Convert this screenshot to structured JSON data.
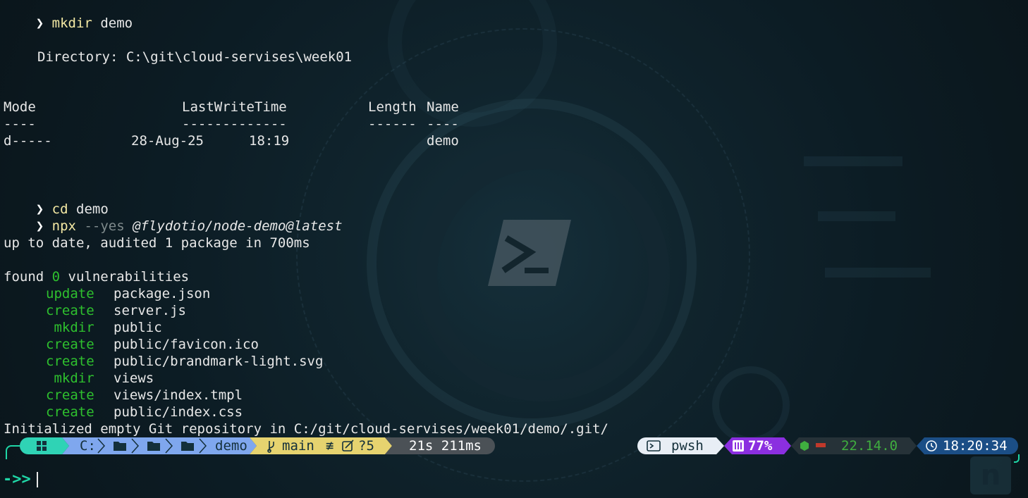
{
  "cmd1": {
    "verb": "mkdir",
    "arg": "demo"
  },
  "directory_line": "Directory: C:\\git\\cloud-servises\\week01",
  "table": {
    "headers": {
      "mode": "Mode",
      "lastwrite": "LastWriteTime",
      "length": "Length",
      "name": "Name"
    },
    "underlines": {
      "mode": "----",
      "lastwrite": "-------------",
      "length": "------",
      "name": "----"
    },
    "row": {
      "mode": "d-----",
      "date": "28-Aug-25",
      "time": "18:19",
      "name": "demo"
    }
  },
  "cmd2": {
    "verb": "cd",
    "arg": "demo"
  },
  "cmd3": {
    "verb": "npx",
    "flag": "--yes",
    "arg": "@flydotio/node-demo@latest"
  },
  "npm_out": {
    "uptodate": "up to date, audited 1 package in 700ms",
    "found_pre": "found ",
    "found_num": "0",
    "found_post": " vulnerabilities"
  },
  "actions": [
    {
      "action": "update",
      "path": "package.json"
    },
    {
      "action": "create",
      "path": "server.js"
    },
    {
      "action": " mkdir",
      "path": "public"
    },
    {
      "action": "create",
      "path": "public/favicon.ico"
    },
    {
      "action": "create",
      "path": "public/brandmark-light.svg"
    },
    {
      "action": " mkdir",
      "path": "views"
    },
    {
      "action": "create",
      "path": "views/index.tmpl"
    },
    {
      "action": "create",
      "path": "public/index.css"
    }
  ],
  "git_init": "Initialized empty Git repository in C:/git/cloud-servises/week01/demo/.git/",
  "prompt": {
    "os_icon": "windows-icon",
    "path_drive": "C:",
    "path_last": "demo",
    "git_branch": "main",
    "git_status_symbol": "≢",
    "git_untracked": "?5",
    "exec_time": "21s 211ms",
    "shell": "pwsh",
    "battery": "77%",
    "node_version": "22.14.0",
    "clock": "18:20:34",
    "colors": {
      "os": "#2fd3b5",
      "path": "#7fa7ee",
      "git": "#e6d36f",
      "time": "#4b5156",
      "shell": "#e8eef5",
      "battery": "#8b2fe0",
      "node": "#263238",
      "clock": "#1b4e86"
    }
  },
  "input_prompt": "->>"
}
